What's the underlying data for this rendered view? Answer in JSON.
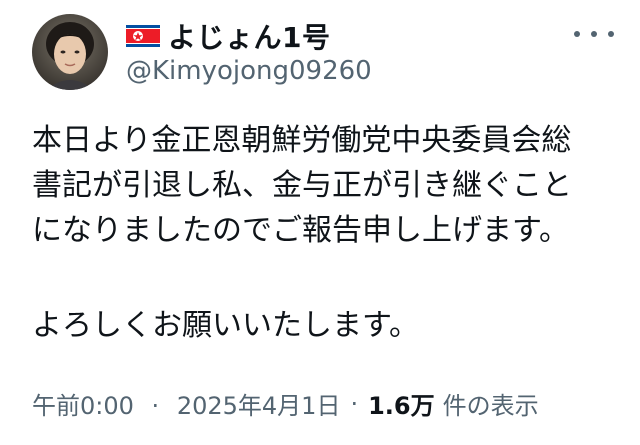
{
  "tweet": {
    "author": {
      "display_name": "よじょん1号",
      "handle": "@Kimyojong09260",
      "flag_icon": "north-korea-flag-icon",
      "flag_colors": {
        "blue": "#024FA2",
        "red": "#ED1C27",
        "white": "#ffffff"
      }
    },
    "text_lines": [
      "本日より金正恩朝鮮労働党中央委員会総",
      "書記が引退し私、金与正が引き継ぐこと",
      "になりましたのでご報告申し上げます。",
      "よろしくお願いいたします。"
    ],
    "time": "午前0:00",
    "date": "2025年4月1日",
    "separator": "·",
    "views_count": "1.6万",
    "views_label": "件の表示"
  }
}
